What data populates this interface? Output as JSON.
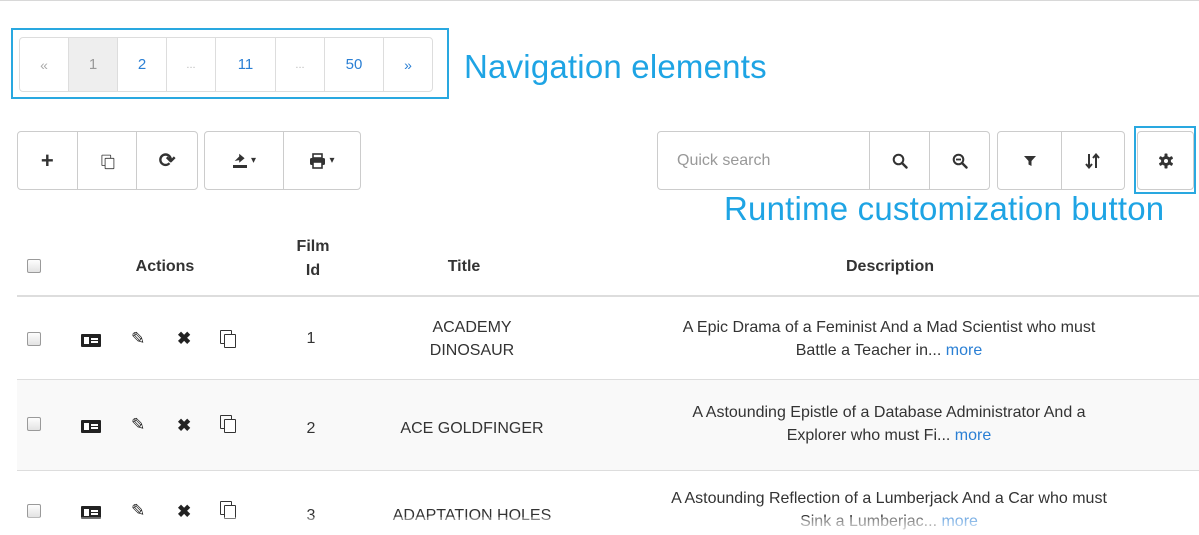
{
  "pagination": {
    "first": "«",
    "pages": [
      "1",
      "2",
      "...",
      "11",
      "...",
      "50"
    ],
    "next": "»"
  },
  "annotations": {
    "navigation": "Navigation elements",
    "customization": "Runtime customization button"
  },
  "toolbar": {
    "add_icon": "+",
    "copy_icon": "⧉",
    "refresh_icon": "⟳",
    "export_icon": "export-icon",
    "print_icon": "print-icon",
    "caret": "▾",
    "search_placeholder": "Quick search",
    "search_icon": "search-icon",
    "reset_search_icon": "zoom-out-icon",
    "filter_icon": "filter-icon",
    "sort_icon": "sort-icon",
    "settings_icon": "gear-icon"
  },
  "table": {
    "columns": {
      "actions": "Actions",
      "film_id_line1": "Film",
      "film_id_line2": "Id",
      "title": "Title",
      "description": "Description"
    },
    "more_label": "more",
    "rows": [
      {
        "id": "1",
        "title_line1": "ACADEMY",
        "title_line2": "DINOSAUR",
        "desc_line1": "A Epic Drama of a Feminist And a Mad Scientist who must",
        "desc_line2": "Battle a Teacher in..."
      },
      {
        "id": "2",
        "title_line1": "ACE GOLDFINGER",
        "desc_line1": "A Astounding Epistle of a Database Administrator And a",
        "desc_line2": "Explorer who must Fi..."
      },
      {
        "id": "3",
        "title_line1": "ADAPTATION HOLES",
        "desc_line1": "A Astounding Reflection of a Lumberjack And a Car who must",
        "desc_line2": "Sink a Lumberjac..."
      }
    ]
  },
  "colors": {
    "accent": "#29a8e0",
    "link": "#2a7fd4",
    "border": "#dddddd"
  }
}
